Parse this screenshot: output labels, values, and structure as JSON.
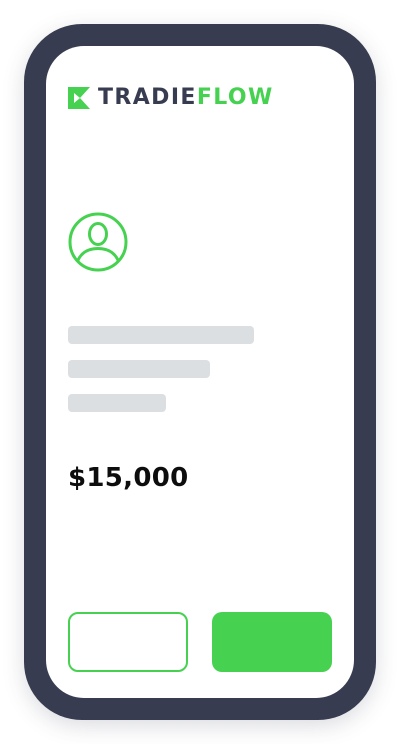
{
  "brand": {
    "name_part_1": "TRADIE",
    "name_part_2": "FLOW",
    "mark": "tradieflow-logo-mark"
  },
  "profile": {
    "avatar_icon": "user-avatar-icon",
    "placeholder_lines": 3
  },
  "quote": {
    "amount": "$15,000"
  },
  "actions": {
    "secondary_label": "",
    "primary_label": ""
  },
  "colors": {
    "frame": "#383c51",
    "accent": "#46d250",
    "placeholder": "#dcdfe2",
    "text": "#0d0d0d"
  }
}
